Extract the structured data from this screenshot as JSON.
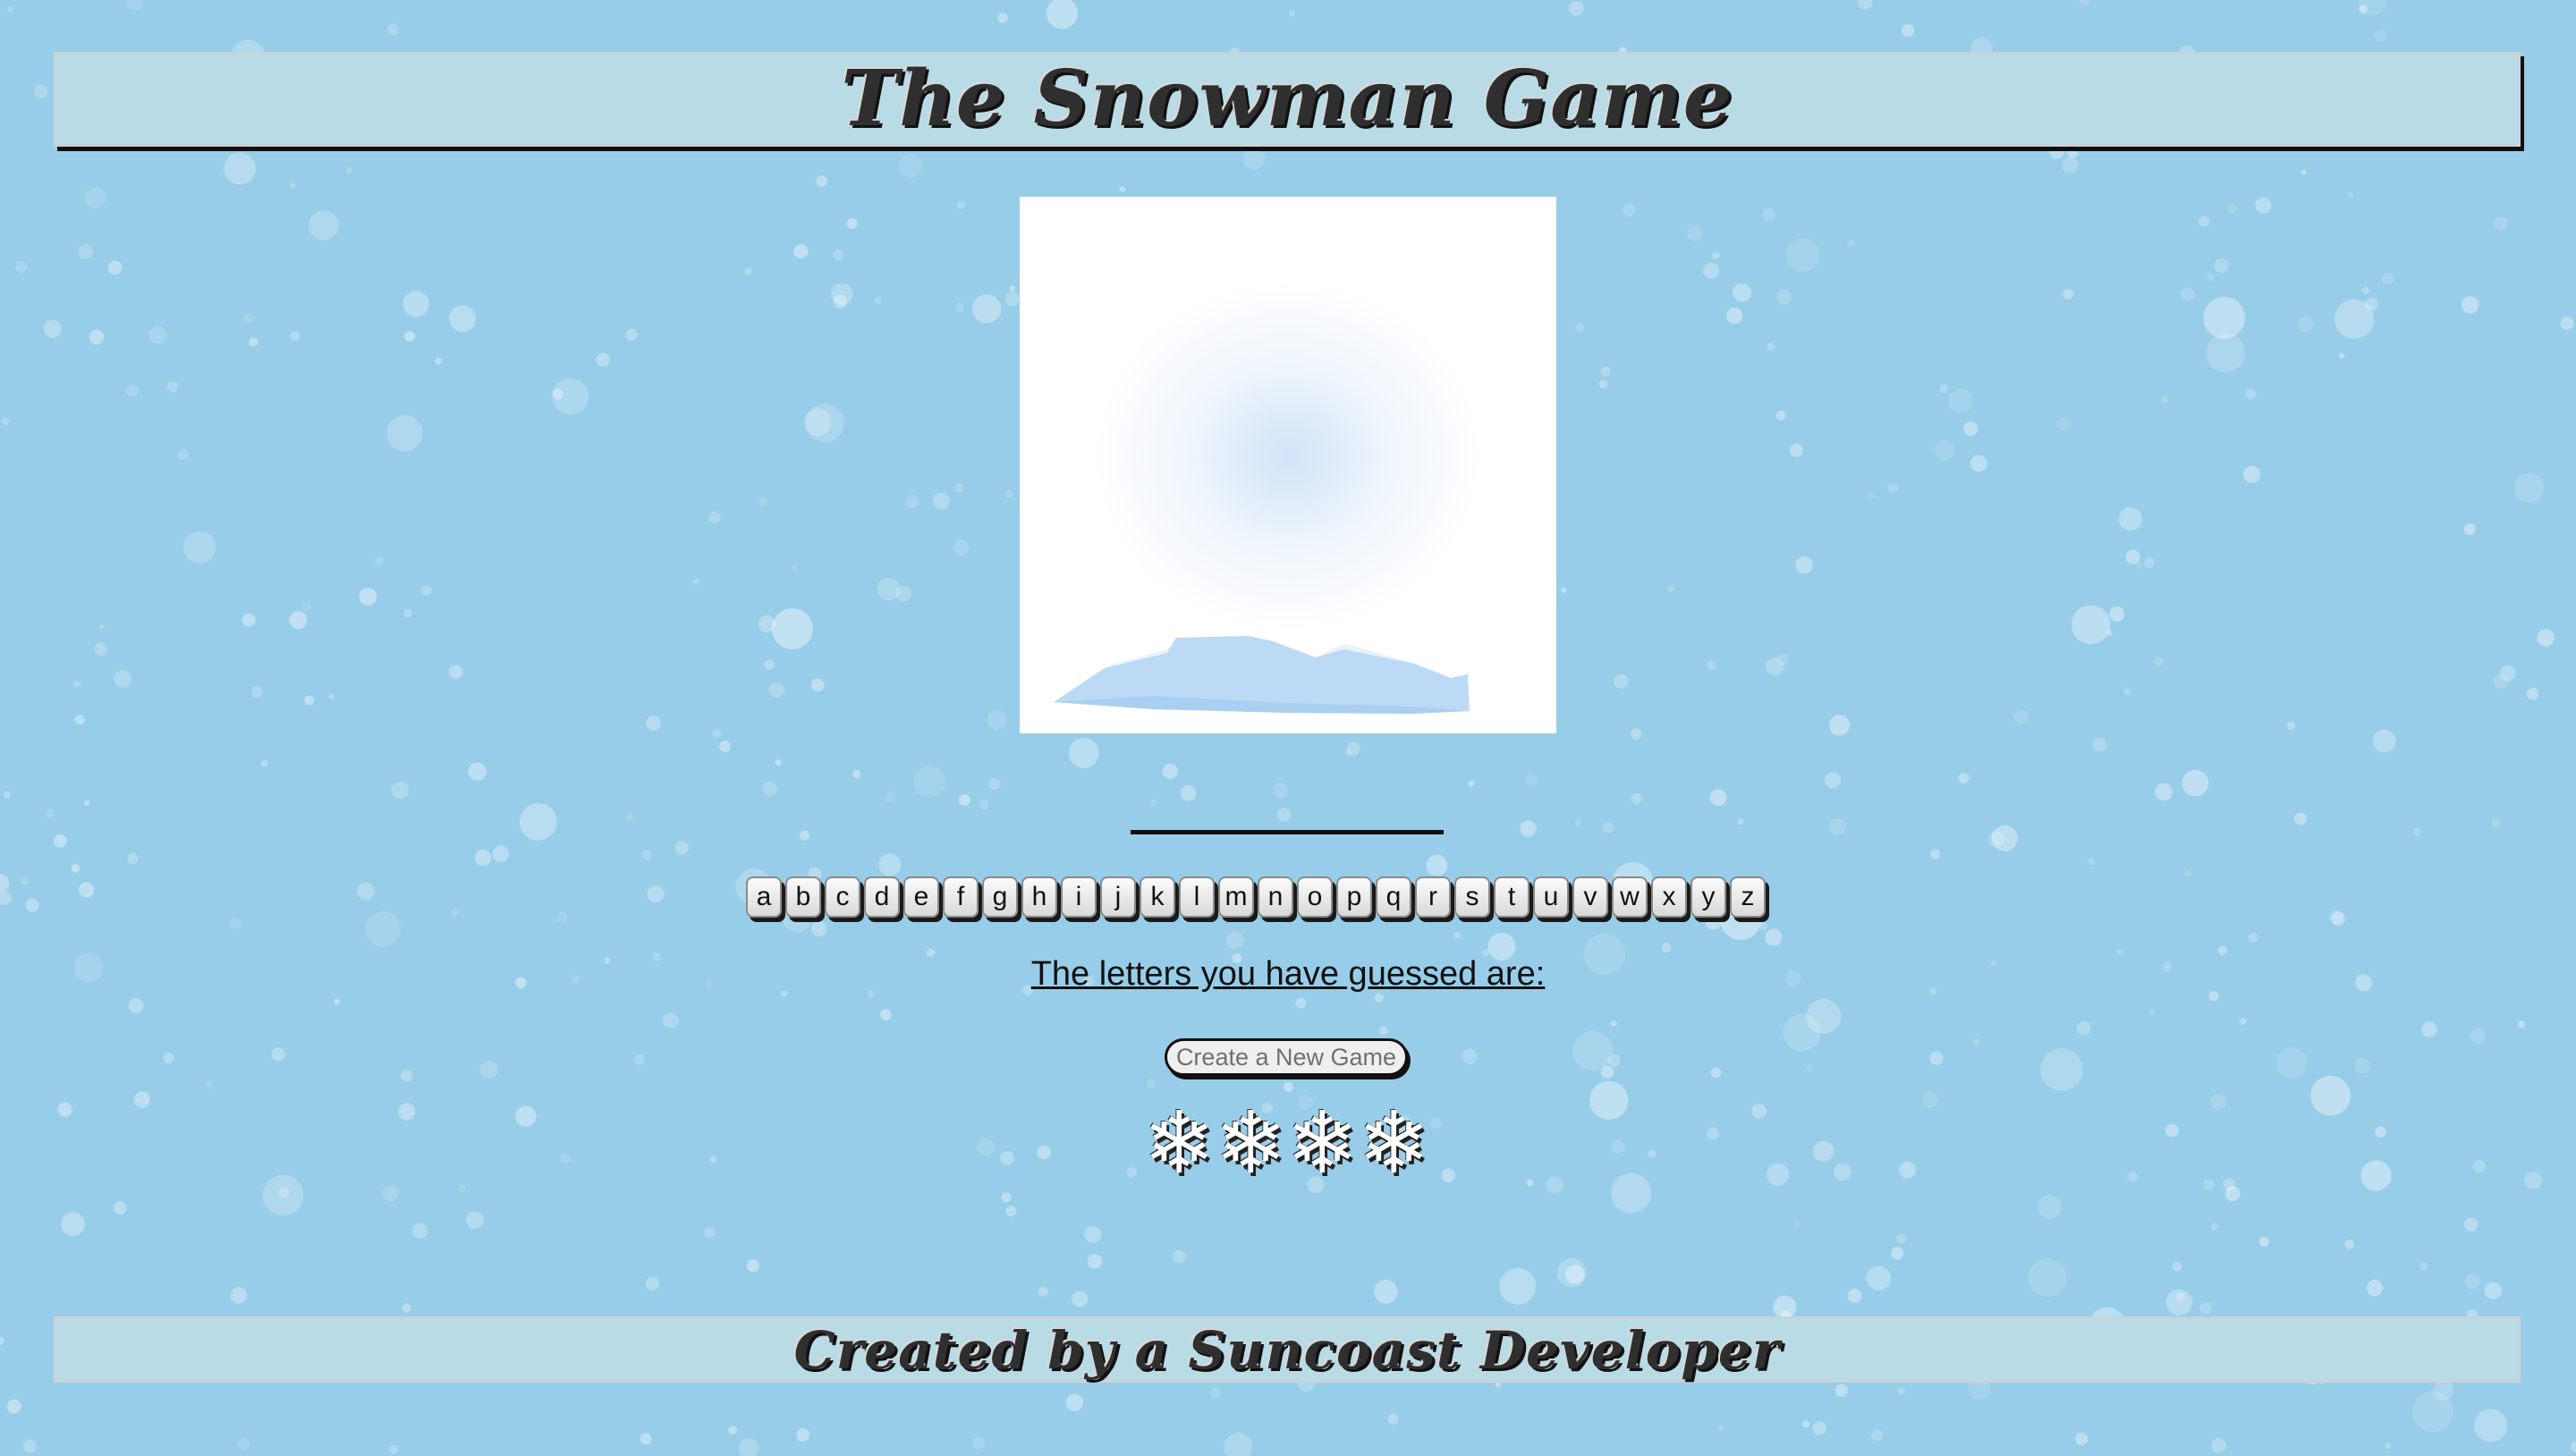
{
  "header": {
    "title": "The Snowman Game"
  },
  "game": {
    "alphabet": [
      "a",
      "b",
      "c",
      "d",
      "e",
      "f",
      "g",
      "h",
      "i",
      "j",
      "k",
      "l",
      "m",
      "n",
      "o",
      "p",
      "q",
      "r",
      "s",
      "t",
      "u",
      "v",
      "w",
      "x",
      "y",
      "z"
    ],
    "guessed_label": "The letters you have guessed are:",
    "new_game_label": "Create a New Game",
    "remaining_flakes": [
      "❄",
      "❄",
      "❄",
      "❄"
    ]
  },
  "footer": {
    "text": "Created by a Suncoast Developer"
  },
  "colors": {
    "background": "#98cde9",
    "banner": "#b9dbe6",
    "snow_drift": "#bcdaf5"
  },
  "icons": {
    "snow_scene": "snowman-scene",
    "life": "snowflake-icon"
  }
}
